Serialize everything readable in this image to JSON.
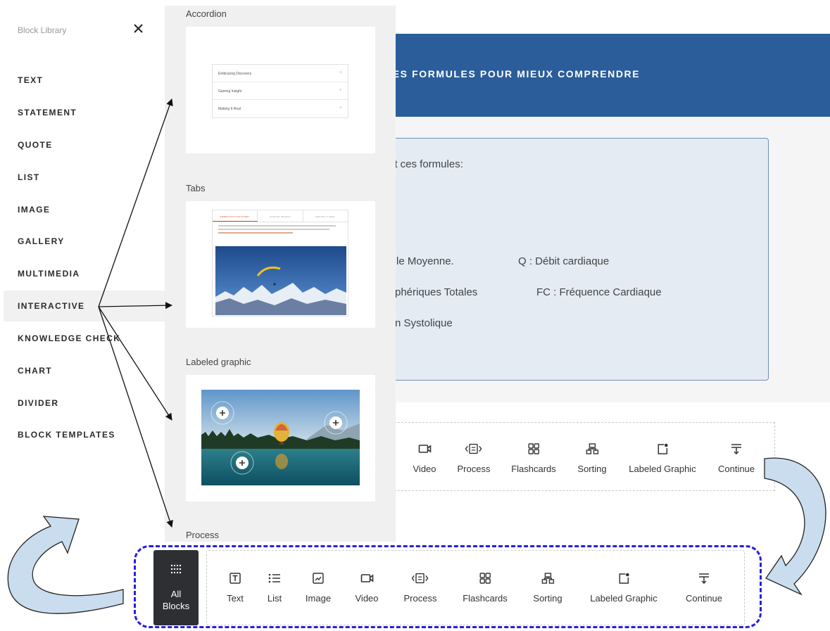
{
  "course": {
    "banner_title": "UES FORMULES POUR MIEUX COMPRENDRE",
    "formula_intro": "rit ces formules:",
    "formula_lines": [
      "le Moyenne.",
      "Q : Débit cardiaque",
      "phériques Totales",
      "FC : Fréquence Cardiaque",
      "n Systolique"
    ]
  },
  "sidebar": {
    "title": "Block Library",
    "close_icon": "close-icon",
    "categories": [
      "TEXT",
      "STATEMENT",
      "QUOTE",
      "LIST",
      "IMAGE",
      "GALLERY",
      "MULTIMEDIA",
      "INTERACTIVE",
      "KNOWLEDGE CHECK",
      "CHART",
      "DIVIDER",
      "BLOCK TEMPLATES"
    ],
    "active_category": "INTERACTIVE"
  },
  "preview": {
    "sections": [
      "Accordion",
      "Tabs",
      "Labeled graphic",
      "Process"
    ],
    "accordion_rows": [
      "Embracing Discovery",
      "Gaining Insight",
      "Making It Real"
    ],
    "tabs_labels": [
      "EMBRACING DISCOVERY",
      "GAINING INSIGHT",
      "MAKING IT REAL"
    ]
  },
  "toolbar_top": {
    "items": [
      "Video",
      "Process",
      "Flashcards",
      "Sorting",
      "Labeled Graphic",
      "Continue"
    ]
  },
  "toolbar_bottom": {
    "all_blocks_line1": "All",
    "all_blocks_line2": "Blocks",
    "items": [
      "Text",
      "List",
      "Image",
      "Video",
      "Process",
      "Flashcards",
      "Sorting",
      "Labeled Graphic",
      "Continue"
    ]
  },
  "colors": {
    "banner": "#2a5d9a",
    "formula_box": "#e4ebf3",
    "dash_frame": "#2421d8",
    "curved_arrow_fill": "#c9ddef",
    "all_blocks_bg": "#2d2f33"
  }
}
